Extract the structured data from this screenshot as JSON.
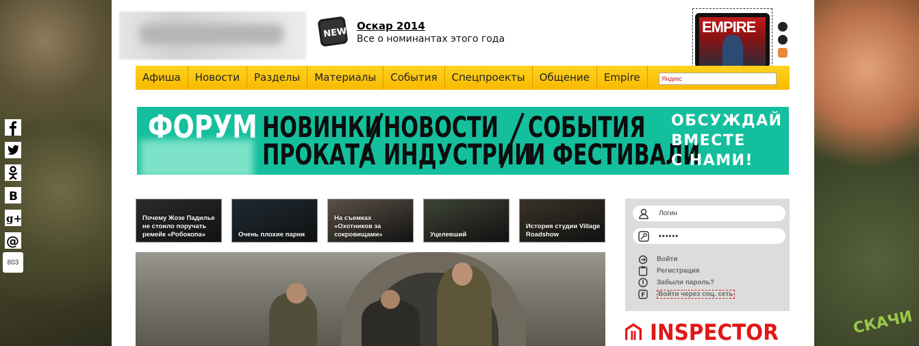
{
  "promo": {
    "badge": "NEW",
    "title": "Оскар 2014",
    "subtitle": "Все о номинантах этого года"
  },
  "magazine": {
    "cover_title": "EMPIRE"
  },
  "nav": {
    "items": [
      "Афиша",
      "Новости",
      "Разделы",
      "Материалы",
      "События",
      "Спецпроекты",
      "Общение",
      "Empire"
    ],
    "search_placeholder": "Яндекс"
  },
  "social": {
    "icons": [
      "facebook-icon",
      "twitter-icon",
      "odnoklassniki-icon",
      "vkontakte-icon",
      "google-plus-icon",
      "email-icon"
    ],
    "count": "803"
  },
  "forum_banner": {
    "title": "ФОРУМ",
    "col1": [
      "НОВИНКИ",
      "ПРОКАТА"
    ],
    "col2": [
      "НОВОСТИ",
      "ИНДУСТРИИ"
    ],
    "col3": [
      "СОБЫТИЯ",
      "И ФЕСТИВАЛИ"
    ],
    "cta": [
      "ОБСУЖДАЙ",
      "ВМЕСТЕ",
      "С НАМИ!"
    ]
  },
  "thumbnails": [
    {
      "caption": "Почему Жозе Падилье не стоило поручать ремейк «Робокопа»",
      "color": "#2b2b2b"
    },
    {
      "caption": "Очень плохие парни",
      "color": "#1e2a33"
    },
    {
      "caption": "На съемках «Охотников за сокровищами»",
      "color": "#5b5246"
    },
    {
      "caption": "Уцелевший",
      "color": "#3e4436"
    },
    {
      "caption": "История студии Village Roadshow",
      "color": "#3a3328"
    }
  ],
  "login": {
    "login_placeholder": "Логин",
    "password_mask": "••••••",
    "links": [
      "Войти",
      "Регистрация",
      "Забыли пароль?",
      "Войти через соц. сеть"
    ]
  },
  "inspector": {
    "label": "INSPECTOR",
    "color": "#e01818"
  },
  "side_art": {
    "right_stamp": "СКАЧИ"
  }
}
